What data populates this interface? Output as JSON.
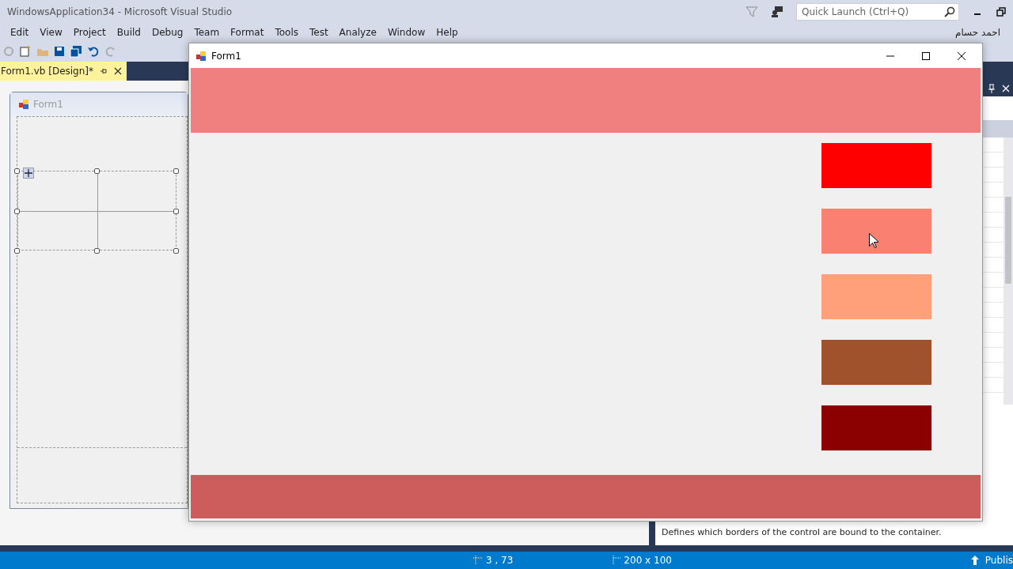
{
  "ide": {
    "title": "WindowsApplication34 - Microsoft Visual Studio",
    "quick_launch": {
      "placeholder": "Quick Launch (Ctrl+Q)"
    },
    "user": "احمد حسام",
    "menu": [
      "Edit",
      "View",
      "Project",
      "Build",
      "Debug",
      "Team",
      "Format",
      "Tools",
      "Test",
      "Analyze",
      "Window",
      "Help"
    ],
    "document_tab": {
      "label": "Form1.vb [Design]*",
      "selected": true
    },
    "designer_form": {
      "title": "Form1"
    },
    "property_description": "Defines which borders of the control are bound to the container.",
    "status_bar": {
      "position": "3 , 73",
      "size": "200 x 100",
      "publish": "Publis"
    }
  },
  "running_form": {
    "title": "Form1",
    "panels": [
      {
        "kind": "header",
        "color": "#f08080"
      },
      {
        "kind": "footer",
        "color": "#cd5c5c"
      }
    ],
    "swatches": [
      {
        "color": "#ff0000"
      },
      {
        "color": "#fa8072"
      },
      {
        "color": "#ffa07a"
      },
      {
        "color": "#a0522d"
      },
      {
        "color": "#8b0000"
      }
    ]
  }
}
